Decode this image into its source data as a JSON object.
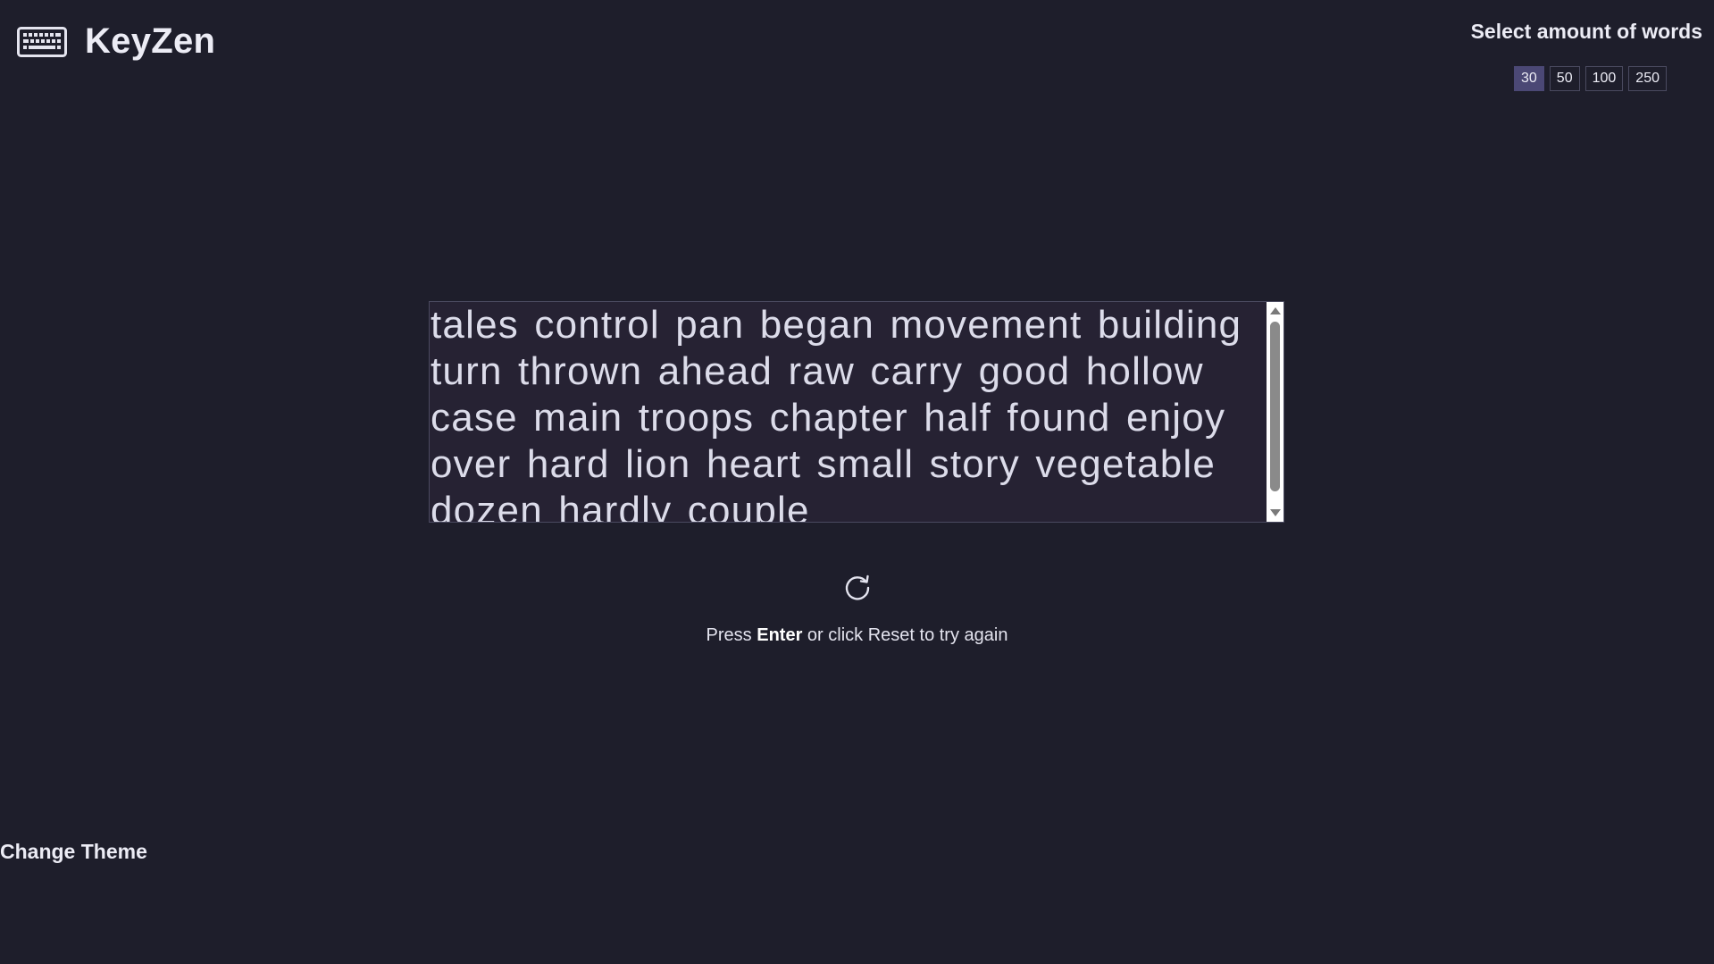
{
  "app": {
    "title": "KeyZen",
    "logo_icon": "keyboard-icon"
  },
  "word_select": {
    "title": "Select amount of words",
    "options": [
      "30",
      "50",
      "100",
      "250"
    ],
    "selected": "30"
  },
  "typing": {
    "text": "tales control pan began movement building turn thrown ahead raw carry good hollow case main troops chapter half found enjoy over hard lion heart small story vegetable dozen hardly couple"
  },
  "reset": {
    "icon": "reset-icon",
    "hint_prefix": "Press",
    "hint_key": "Enter",
    "hint_suffix": "or click Reset to try again"
  },
  "footer": {
    "change_theme_label": "Change Theme"
  },
  "colors": {
    "background": "#1e1e2b",
    "text": "#e4e4ef",
    "active_option": "#4b4875",
    "textbox_background": "#262233"
  }
}
